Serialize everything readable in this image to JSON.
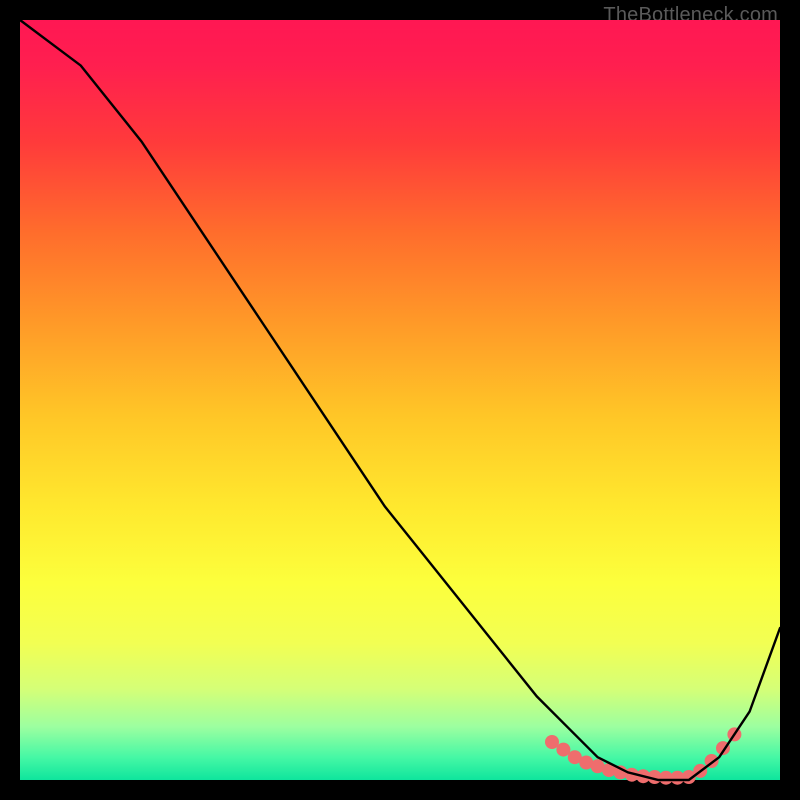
{
  "watermark": "TheBottleneck.com",
  "chart_data": {
    "type": "line",
    "title": "",
    "xlabel": "",
    "ylabel": "",
    "xlim": [
      0,
      100
    ],
    "ylim": [
      0,
      100
    ],
    "series": [
      {
        "name": "bottleneck-curve",
        "color": "#000000",
        "x": [
          0,
          4,
          8,
          12,
          16,
          20,
          24,
          28,
          32,
          36,
          40,
          44,
          48,
          52,
          56,
          60,
          64,
          68,
          72,
          76,
          80,
          84,
          88,
          92,
          96,
          100
        ],
        "y": [
          100,
          97,
          94,
          89,
          84,
          78,
          72,
          66,
          60,
          54,
          48,
          42,
          36,
          31,
          26,
          21,
          16,
          11,
          7,
          3,
          1,
          0,
          0,
          3,
          9,
          20
        ]
      }
    ],
    "markers": {
      "name": "optimal-range-markers",
      "color": "#ef6d6d",
      "x": [
        70,
        71.5,
        73,
        74.5,
        76,
        77.5,
        79,
        80.5,
        82,
        83.5,
        85,
        86.5,
        88,
        89.5,
        91,
        92.5,
        94
      ],
      "y": [
        5,
        4,
        3,
        2.3,
        1.8,
        1.3,
        1,
        0.7,
        0.5,
        0.4,
        0.3,
        0.3,
        0.4,
        1.2,
        2.5,
        4.2,
        6
      ]
    }
  }
}
